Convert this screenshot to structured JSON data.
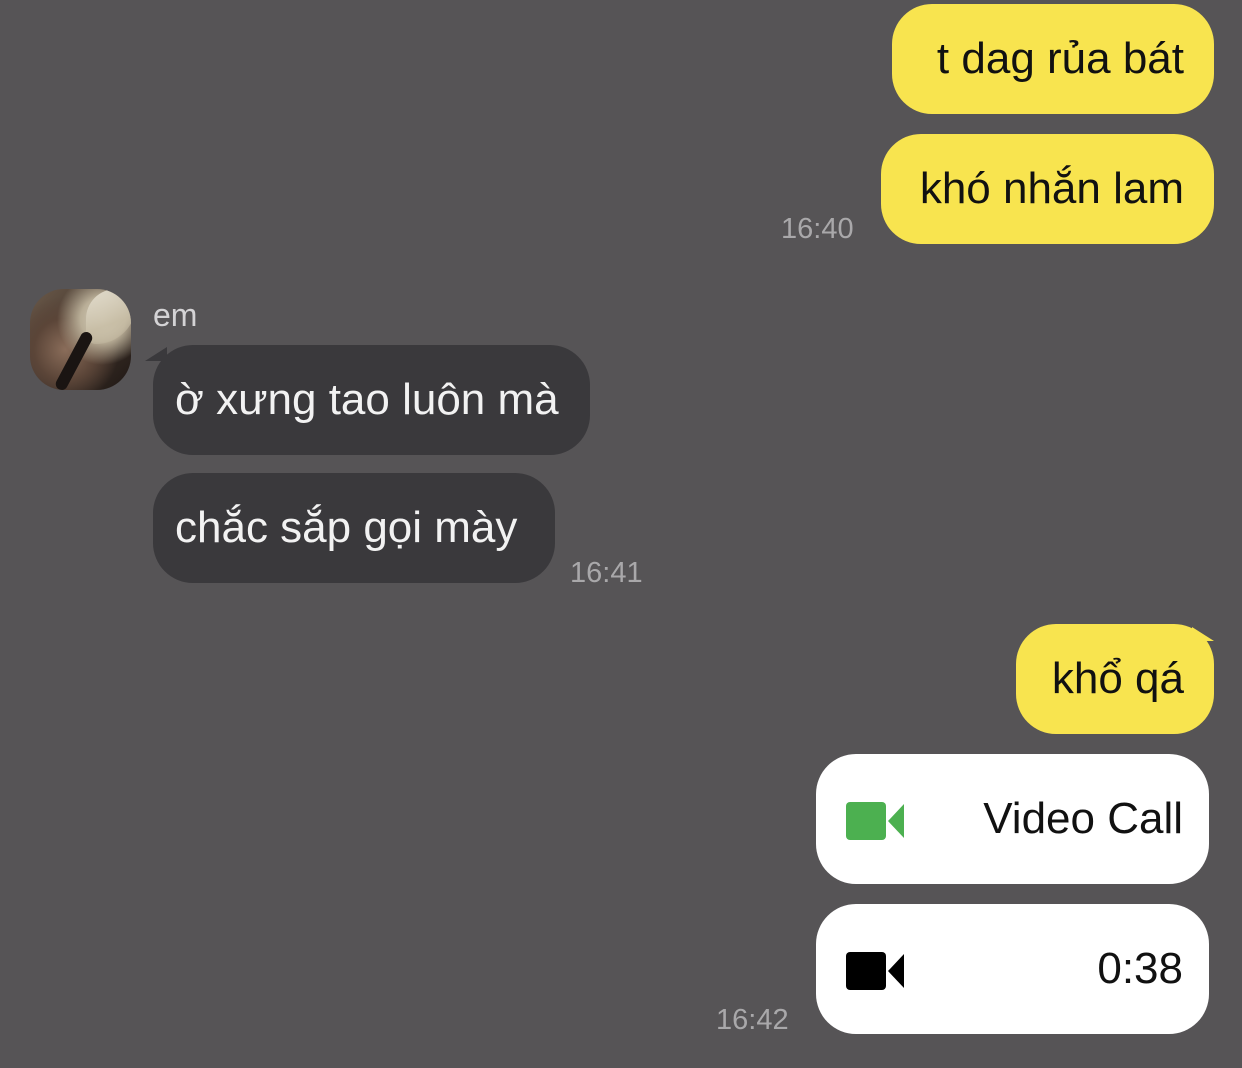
{
  "colors": {
    "background": "#565456",
    "my_bubble": "#F8E44F",
    "their_bubble": "#3A393C",
    "call_card": "#FFFFFF",
    "video_icon_green": "#4CB050",
    "video_icon_black": "#000000",
    "timestamp": "#A9A8AA"
  },
  "messages": {
    "m1": {
      "text": "t dag rủa bát"
    },
    "m2": {
      "text": "khó nhắn lam",
      "time": "16:40"
    },
    "sender_name": "em",
    "m3": {
      "text": "ờ xưng tao luôn mà"
    },
    "m4": {
      "text": "chắc sắp gọi mày",
      "time": "16:41"
    },
    "m5": {
      "text": "khổ qá"
    },
    "call1": {
      "label": "Video Call",
      "icon": "video-camera-icon"
    },
    "call2": {
      "label": "0:38",
      "icon": "video-camera-icon",
      "time": "16:42"
    }
  }
}
